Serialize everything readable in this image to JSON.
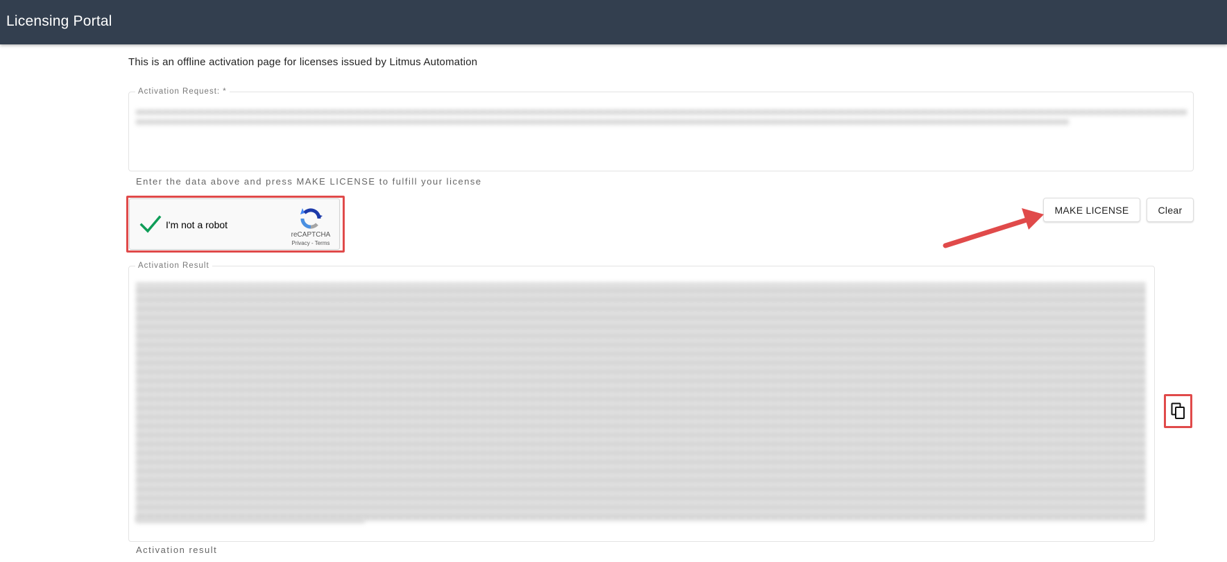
{
  "header": {
    "title": "Licensing Portal",
    "background_color": "#333f4f"
  },
  "intro": {
    "text": "This is an offline activation page for licenses issued by Litmus Automation"
  },
  "activation_request": {
    "label": "Activation Request: *",
    "helper": "Enter the data above and press MAKE LICENSE to fulfill your license"
  },
  "captcha": {
    "label": "I'm not a robot",
    "brand": "reCAPTCHA",
    "links": "Privacy - Terms",
    "checked": true
  },
  "actions": {
    "make_license_label": "MAKE LICENSE",
    "clear_label": "Clear"
  },
  "activation_result": {
    "label": "Activation Result",
    "helper": "Activation result"
  },
  "icons": {
    "check": "check-icon",
    "recaptcha": "recaptcha-logo-icon",
    "copy": "copy-icon",
    "annotation_arrow": "arrow-icon"
  },
  "annotation_color": "#e04a4a"
}
